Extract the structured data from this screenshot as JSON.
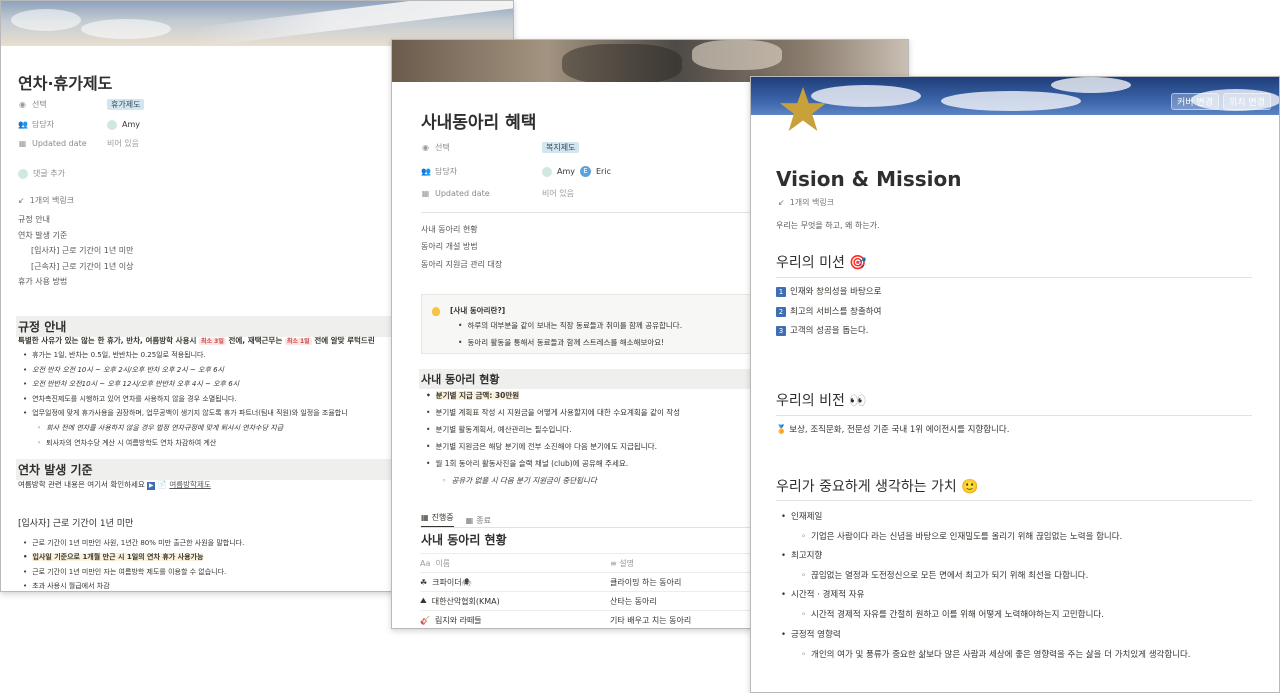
{
  "card1": {
    "title": "연차·휴가제도",
    "props": {
      "select_label": "선택",
      "select_value": "휴가제도",
      "owner_label": "담당자",
      "owner_value": "Amy",
      "updated_label": "Updated date",
      "updated_value": "비어 있음"
    },
    "add_comment": "댓글 추가",
    "backlinks": "1개의 백링크",
    "toc": [
      "규정 안내",
      "연차 발생 기준",
      "[입사자] 근로 기간이 1년 미만",
      "[근속자] 근로 기간이 1년 이상",
      "휴가 사용 방법"
    ],
    "rules": {
      "heading": "규정 안내",
      "intro_a": "특별한 사유가 있는 않는 한 휴가, 반차, 여름방학 사용시",
      "intro_tag1": "최소 3일",
      "intro_b": "전에, 재택근무는",
      "intro_tag2": "최소 1일",
      "intro_c": "전에 알맞 루턱드린",
      "bullets": [
        "휴가는 1일, 반차는 0.5일, 반반차는 0.25일로 적용됩니다.",
        "오전 반차 오전 10시 ~ 오후 2시/오후 반차 오후 2시 ~ 오후 6시",
        "오전 반반차 오전10시 ~ 오후 12시/오후 반반차 오후 4시 ~ 오후 6시",
        "연차촉진제도를 시행하고 있어 연차를 사용하지 않을 경우 소멸됩니다.",
        "업무일정에 맞게 휴가사용을 권장하며, 업무공백이 생기지 않도록 휴가 파트너(팀내 직원)와 일정을 조율합니"
      ],
      "sub_bullets": [
        "회사 전에 연차를 사용하지 않을 경우 법정 연차규정에 맞게 퇴사시 연차수당 지급",
        "퇴사자의 연차수당 계산 시 여름방학도 연차 차감하여 계산"
      ]
    },
    "accrual": {
      "heading": "연차 발생 기준",
      "note": "여름방학 관련 내용은 여기서 확인하세요",
      "link": "여름방학제도"
    },
    "newcomer": {
      "heading": "[입사자] 근로 기간이 1년 미만",
      "bullets": [
        "근로 기간이 1년 미만인 사원, 1년간 80% 미만 출근한 사원을 말합니다.",
        "입사일 기준으로 1개월 만근 시 1일의 연차 휴가 사용가능",
        "근로 기간이 1년 미만인 자는 여름방학 제도를 이용할 수 없습니다.",
        "초과 사용시 월급에서 차감"
      ]
    }
  },
  "card2": {
    "title": "사내동아리 혜택",
    "props": {
      "select_label": "선택",
      "select_value": "복지제도",
      "owner_label": "담당자",
      "owner_values": [
        "Amy",
        "Eric"
      ],
      "updated_label": "Updated date",
      "updated_value": "비어 있음"
    },
    "toc": [
      "사내 동아리 현황",
      "동아리 개설 방법",
      "동아리 지원금 관리 대장"
    ],
    "callout": {
      "title": "[사내 동아리란?]",
      "items": [
        "하루의 대부분을 같이 보내는 직장 동료들과 취미를 함께 공유합니다.",
        "동아리 활동을 통해서 동료들과 함께 스트레스를 해소해보아요!"
      ]
    },
    "status": {
      "heading": "사내 동아리 현황",
      "bullets": [
        "분기별 지급 금액: 30만원",
        "분기별 계획표 작성 시 지원금을 어떻게 사용할지에 대한 수요계획을 같이 작성",
        "분기별 활동계획서, 예산관리는 필수입니다.",
        "분기별 지원금은 해당 분기에 전부 소진해야 다음 분기에도 지급됩니다.",
        "월 1회 동아리 활동사진을 슬랙 채널 (club)에 공유해 주세요."
      ],
      "sub": "공유가 없을 시 다음 분기 지원금이 중단됩니다"
    },
    "tabs": [
      "진행중",
      "종료"
    ],
    "db_title": "사내 동아리 현황",
    "db_columns": [
      "이름",
      "설명"
    ],
    "db_rows": [
      {
        "icon": "☘",
        "name": "크파이더🕷",
        "desc": "클라이밍 하는 동아리"
      },
      {
        "icon": "⛰",
        "name": "대한산악협회(KMA)",
        "desc": "산타는 동아리"
      },
      {
        "icon": "🎸",
        "name": "림지와 라떼들",
        "desc": "기타 배우고 치는 동아리"
      }
    ]
  },
  "card3": {
    "cover_buttons": [
      "커버 변경",
      "위치 변경"
    ],
    "title": "Vision & Mission",
    "backlinks": "1개의 백링크",
    "intro": "우리는 무엇을 하고, 왜 하는가.",
    "mission": {
      "heading": "우리의 미션 🎯",
      "items": [
        "인재와 창의성을 바탕으로",
        "최고의 서비스를 창출하여",
        "고객의 성공을 돕는다."
      ]
    },
    "vision": {
      "heading": "우리의 비전 👀",
      "item": "🏅 보상, 조직문화, 전문성 기준 국내 1위 에이전시를 지향합니다."
    },
    "values": {
      "heading": "우리가 중요하게 생각하는 가치 🙂",
      "items": [
        {
          "name": "인재제일",
          "desc": "기업은 사람이다 라는 신념을 바탕으로 인재밀도를 올리기 위해 끊임없는 노력을 합니다."
        },
        {
          "name": "최고지향",
          "desc": "끊임없는 열정과 도전정신으로 모든 면에서 최고가 되기 위해 최선을 다합니다."
        },
        {
          "name": "시간적 · 경제적 자유",
          "desc": "시간적 경제적 자유를 간절히 원하고 이를 위해 어떻게 노력해야하는지 고민합니다."
        },
        {
          "name": "긍정적 영향력",
          "desc": "개인의 여가 및 풍류가 중요한 삶보다 많은 사람과 세상에 좋은 영향력을 주는 삶을 더 가치있게 생각합니다."
        }
      ]
    }
  },
  "colors": {
    "select_tag_bg": "#d3e5ef",
    "highlight_yellow": "#fbf3db",
    "red_tag": "#d24545",
    "star_gold": "#c9a13b",
    "cover_blue": "#2d4f8f"
  }
}
